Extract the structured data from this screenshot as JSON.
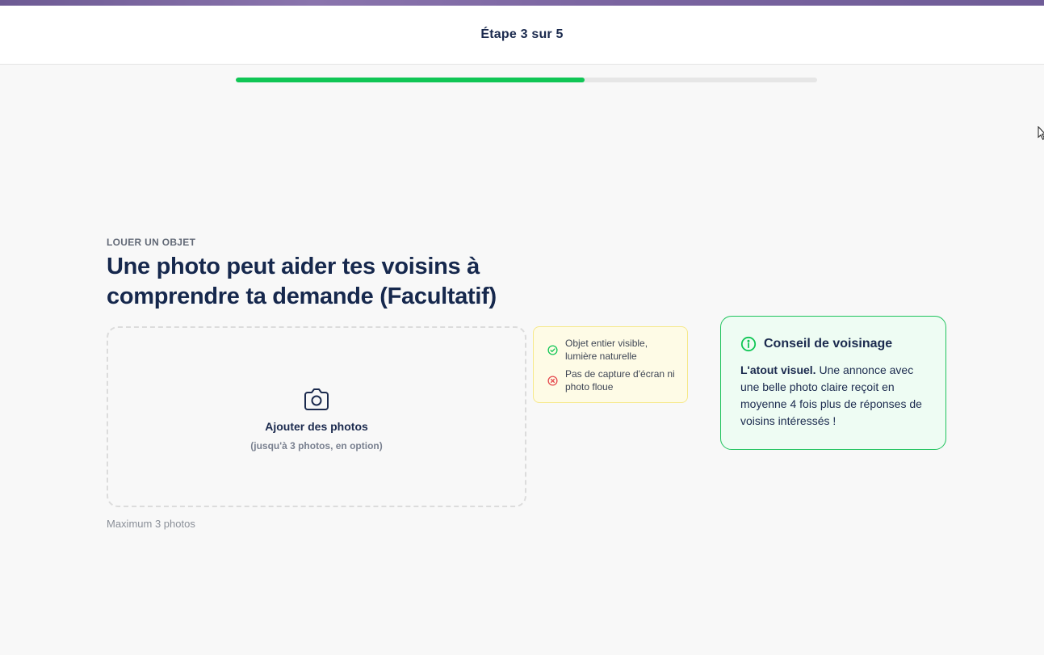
{
  "header": {
    "step_label": "Étape 3 sur 5"
  },
  "progress": {
    "fraction": 0.6
  },
  "main": {
    "eyebrow": "LOUER UN OBJET",
    "title": "Une photo peut aider tes voisins à comprendre ta demande (Facultatif)"
  },
  "upload": {
    "icon": "camera-icon",
    "label": "Ajouter des photos",
    "sublabel": "(jusqu'à 3 photos, en option)",
    "max_note": "Maximum 3 photos"
  },
  "tips": {
    "items": [
      {
        "icon": "check-circle-icon",
        "text": "Objet entier visible, lumière naturelle",
        "color": "#10c655"
      },
      {
        "icon": "x-circle-icon",
        "text": "Pas de capture d'écran ni photo floue",
        "color": "#e5484d"
      }
    ]
  },
  "advice": {
    "icon": "info-icon",
    "title": "Conseil de voisinage",
    "strong": "L'atout visuel.",
    "body": " Une annonce avec une belle photo claire reçoit en moyenne 4 fois plus de réponses de voisins intéressés !"
  },
  "colors": {
    "accent": "#10c655",
    "text_primary": "#1b2a4e",
    "error": "#e5484d",
    "tips_bg": "#fefbe6",
    "advice_bg": "#eefcf3"
  }
}
